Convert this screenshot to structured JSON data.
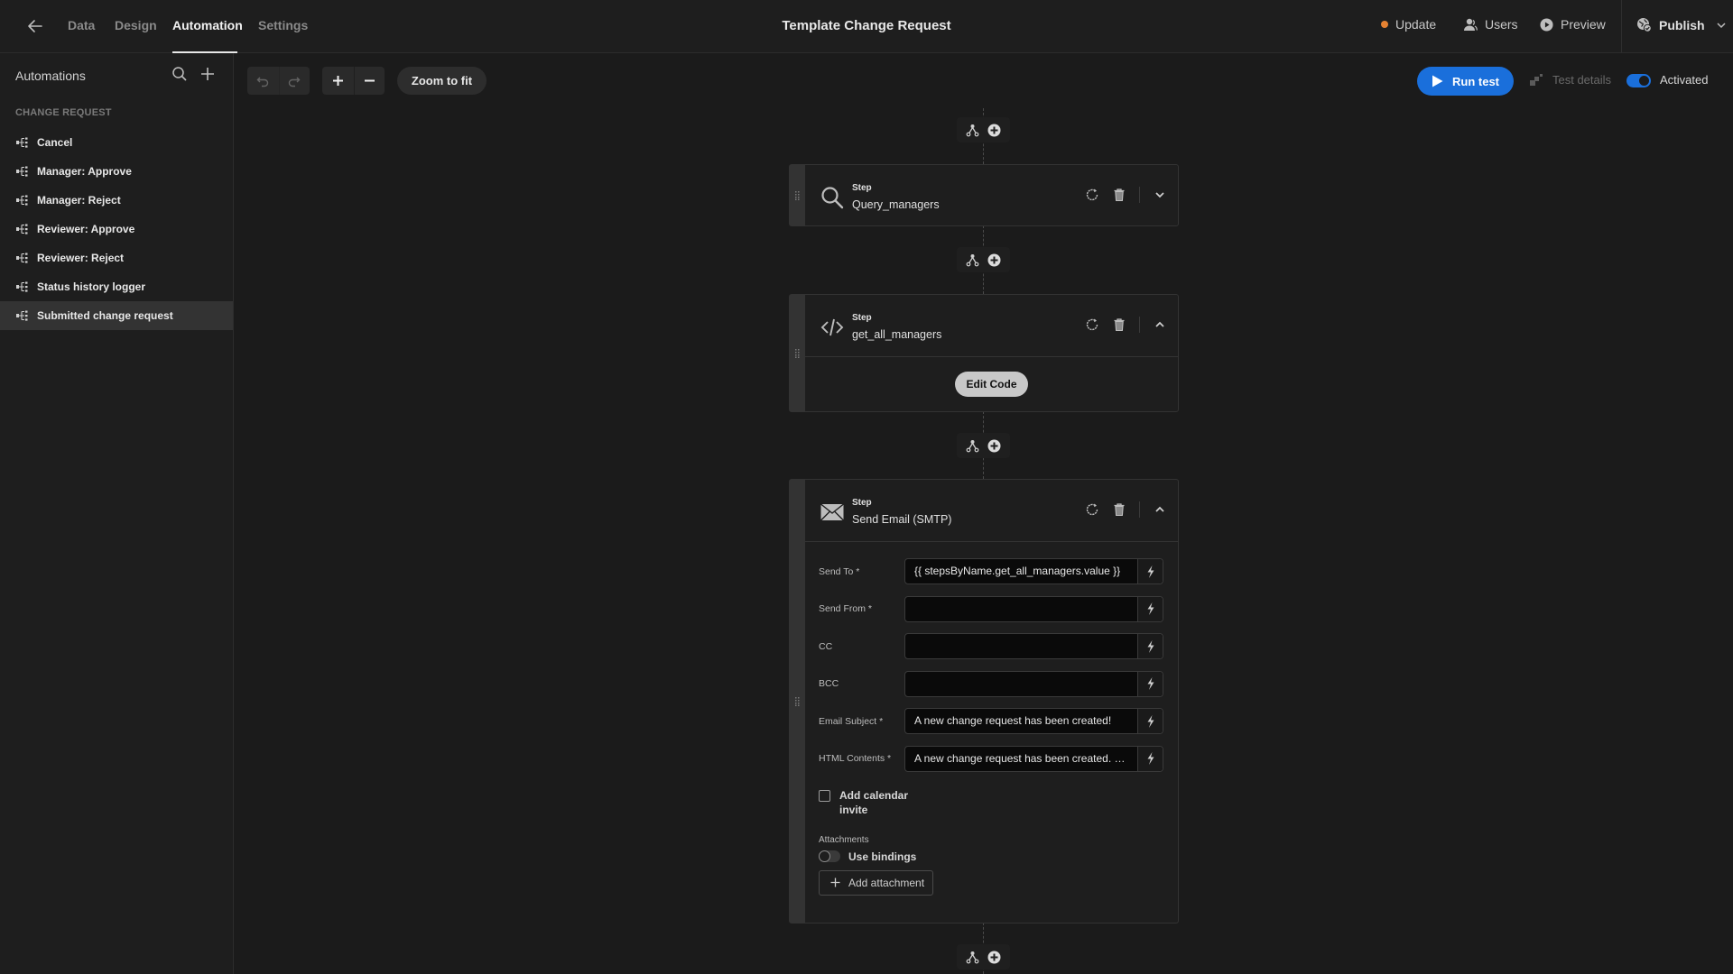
{
  "header": {
    "back_label": "Back",
    "tabs": [
      {
        "label": "Data",
        "active": false
      },
      {
        "label": "Design",
        "active": false
      },
      {
        "label": "Automation",
        "active": true
      },
      {
        "label": "Settings",
        "active": false
      }
    ],
    "title": "Template Change Request",
    "update_label": "Update",
    "update_dot_color": "#e68232",
    "users_label": "Users",
    "preview_label": "Preview",
    "publish_label": "Publish"
  },
  "sidebar": {
    "title": "Automations",
    "section": "CHANGE REQUEST",
    "items": [
      {
        "label": "Cancel",
        "selected": false
      },
      {
        "label": "Manager: Approve",
        "selected": false
      },
      {
        "label": "Manager: Reject",
        "selected": false
      },
      {
        "label": "Reviewer: Approve",
        "selected": false
      },
      {
        "label": "Reviewer: Reject",
        "selected": false
      },
      {
        "label": "Status history logger",
        "selected": false
      },
      {
        "label": "Submitted change request",
        "selected": true
      }
    ]
  },
  "toolbar": {
    "zoom_to_fit_label": "Zoom to fit",
    "run_test_label": "Run test",
    "test_details_label": "Test details",
    "activated_label": "Activated",
    "activated": true,
    "accent_color": "#1a6fdb"
  },
  "steps": [
    {
      "kind": "Step",
      "name": "Query_managers",
      "icon": "search-icon",
      "expanded": false
    },
    {
      "kind": "Step",
      "name": "get_all_managers",
      "icon": "code-icon",
      "expanded": true,
      "edit_code_label": "Edit Code"
    },
    {
      "kind": "Step",
      "name": "Send Email (SMTP)",
      "icon": "envelope-icon",
      "expanded": true,
      "fields": [
        {
          "label": "Send To *",
          "value": "{{ stepsByName.get_all_managers.value }}"
        },
        {
          "label": "Send From *",
          "value": ""
        },
        {
          "label": "CC",
          "value": ""
        },
        {
          "label": "BCC",
          "value": ""
        },
        {
          "label": "Email Subject *",
          "value": "A new change request has been created!"
        },
        {
          "label": "HTML Contents *",
          "value": "A new change request has been created. Ca…"
        }
      ],
      "calendar_invite_label": "Add calendar invite",
      "calendar_invite_checked": false,
      "attachments_label": "Attachments",
      "use_bindings_label": "Use bindings",
      "use_bindings": false,
      "add_attachment_label": "Add attachment"
    }
  ]
}
